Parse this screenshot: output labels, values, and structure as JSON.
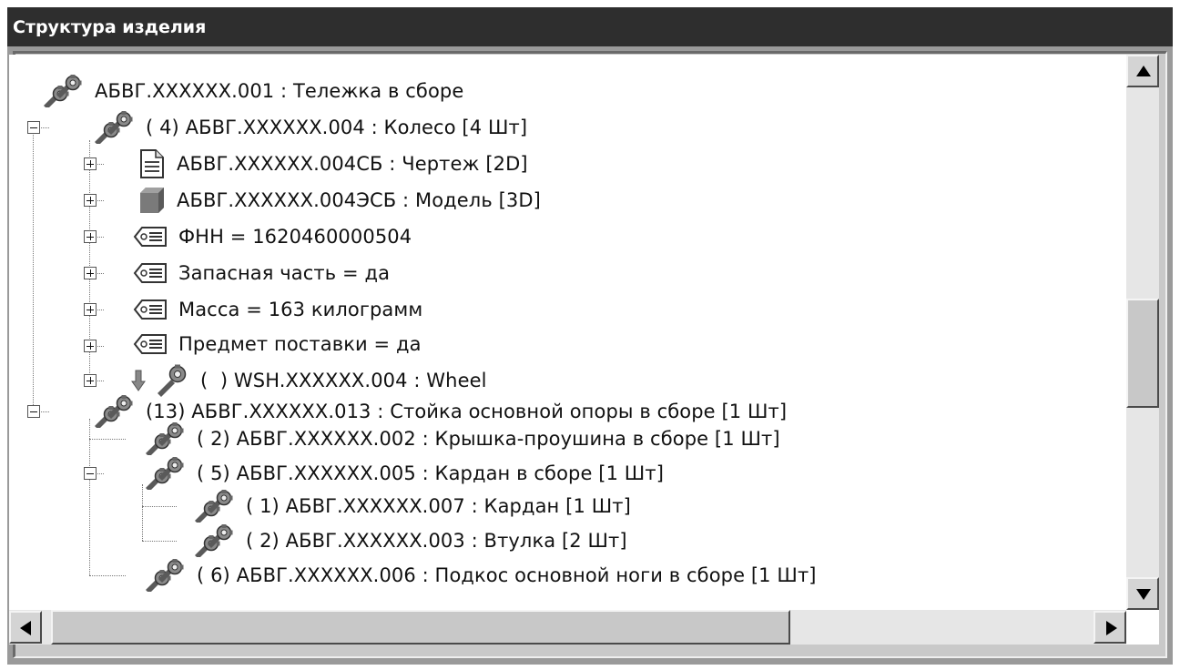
{
  "window": {
    "title": "Структура изделия"
  },
  "tree": {
    "items": [
      {
        "label": "АБВГ.XXXXXX.001 : Тележка в сборе",
        "icon": "assembly-icon"
      },
      {
        "label": "( 4) АБВГ.XXXXXX.004 : Колесо [4 Шт]",
        "icon": "assembly-icon",
        "state": "expanded"
      },
      {
        "label": "АБВГ.XXXXXX.004СБ : Чертеж [2D]",
        "icon": "document-icon",
        "state": "collapsed"
      },
      {
        "label": "АБВГ.XXXXXX.004ЭСБ : Модель [3D]",
        "icon": "model-icon",
        "state": "collapsed"
      },
      {
        "label": "ФНН = 1620460000504",
        "icon": "attribute-icon",
        "state": "collapsed"
      },
      {
        "label": "Запасная часть = да",
        "icon": "attribute-icon",
        "state": "collapsed"
      },
      {
        "label": "Масса = 163 килограмм",
        "icon": "attribute-icon",
        "state": "collapsed"
      },
      {
        "label": "Предмет поставки = да",
        "icon": "attribute-icon",
        "state": "collapsed"
      },
      {
        "label": "(  ) WSH.XXXXXX.004 : Wheel",
        "icon": "part-icon",
        "state": "collapsed"
      },
      {
        "label": "(13) АБВГ.XXXXXX.013 : Стойка основной опоры в сборе [1 Шт]",
        "icon": "assembly-icon",
        "state": "expanded"
      },
      {
        "label": "( 2) АБВГ.XXXXXX.002 : Крышка-проушина в сборе [1 Шт]",
        "icon": "assembly-icon"
      },
      {
        "label": "( 5) АБВГ.XXXXXX.005 : Кардан в сборе [1 Шт]",
        "icon": "assembly-icon",
        "state": "expanded"
      },
      {
        "label": "( 1) АБВГ.XXXXXX.007 : Кардан [1 Шт]",
        "icon": "assembly-icon"
      },
      {
        "label": "( 2) АБВГ.XXXXXX.003 : Втулка [2 Шт]",
        "icon": "assembly-icon"
      },
      {
        "label": "( 6) АБВГ.XXXXXX.006 : Подкос основной ноги в сборе [1 Шт]",
        "icon": "assembly-icon"
      }
    ]
  },
  "scrollbars": {
    "vertical_position": 0.6,
    "horizontal_position": 0.0
  },
  "colors": {
    "titlebar": "#2e2e2e",
    "tree_background": "#ffffff",
    "frame": "#c9c9c9"
  }
}
